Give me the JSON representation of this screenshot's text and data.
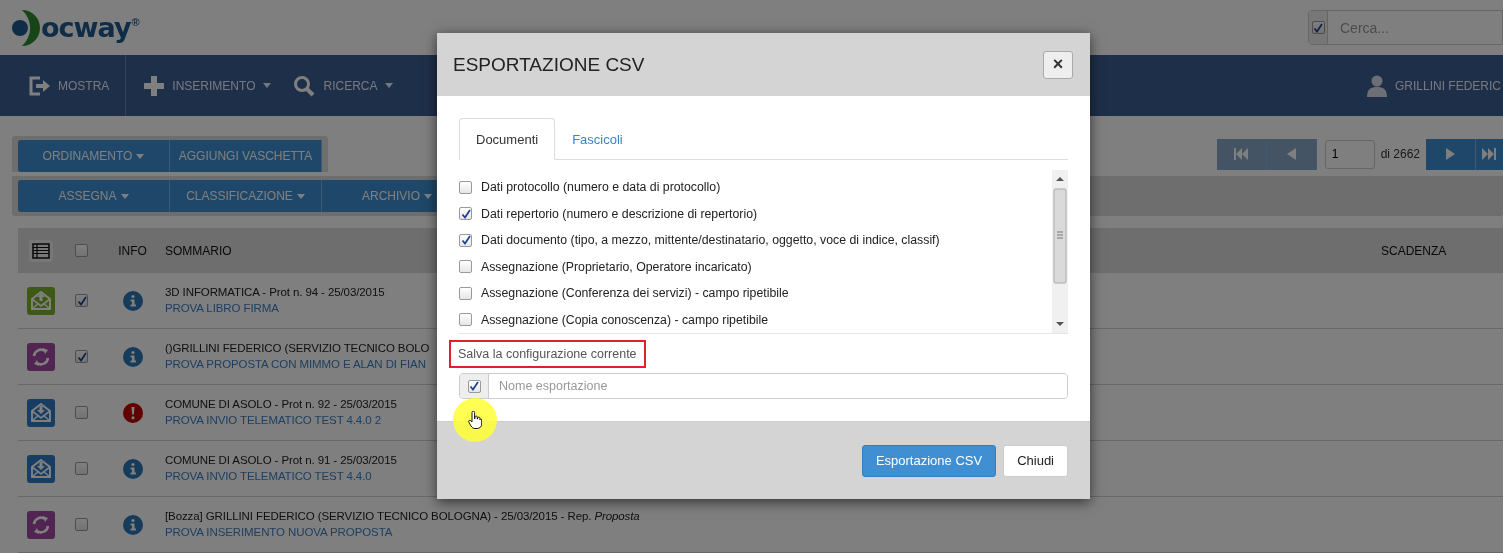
{
  "logo": {
    "text": "ocway",
    "mark": "®"
  },
  "search": {
    "placeholder": "Cerca...",
    "checked": true
  },
  "nav": {
    "items": [
      {
        "label": "MOSTRA",
        "kind": "exit",
        "dropdown": false
      },
      {
        "label": "INSERIMENTO",
        "kind": "plus",
        "dropdown": true
      },
      {
        "label": "RICERCA",
        "kind": "search",
        "dropdown": true
      }
    ],
    "user": "GRILLINI FEDERIC"
  },
  "toolbar": {
    "rows": [
      [
        {
          "label": "ORDINAMENTO",
          "dropdown": true
        },
        {
          "label": "AGGIUNGI VASCHETTA",
          "dropdown": false
        }
      ],
      [
        {
          "label": "ASSEGNA",
          "dropdown": true
        },
        {
          "label": "CLASSIFICAZIONE",
          "dropdown": true
        },
        {
          "label": "ARCHIVIO",
          "dropdown": true
        }
      ]
    ]
  },
  "pagination": {
    "page": "1",
    "total": "di 2662"
  },
  "table": {
    "columns": [
      "INFO",
      "SOMMARIO",
      "SCADENZA"
    ],
    "all_checked": false,
    "rows": [
      {
        "kind": "outgoing",
        "checked": true,
        "alert": false,
        "title": "3D INFORMATICA - Prot n. 94 - 25/03/2015",
        "subtitle": "PROVA LIBRO FIRMA"
      },
      {
        "kind": "proposal",
        "checked": true,
        "alert": false,
        "title": "()GRILLINI FEDERICO (SERVIZIO TECNICO BOLO",
        "subtitle": "PROVA PROPOSTA CON MIMMO E ALAN DI FIAN"
      },
      {
        "kind": "incoming",
        "checked": false,
        "alert": true,
        "title": "COMUNE DI ASOLO - Prot n. 92 - 25/03/2015",
        "subtitle": "PROVA INVIO TELEMATICO TEST 4.4.0 2"
      },
      {
        "kind": "incoming",
        "checked": false,
        "alert": false,
        "title": "COMUNE DI ASOLO - Prot n. 91 - 25/03/2015",
        "subtitle": "PROVA INVIO TELEMATICO TEST 4.4.0"
      },
      {
        "kind": "proposal",
        "checked": false,
        "alert": false,
        "title": "[Bozza] GRILLINI FEDERICO (SERVIZIO TECNICO BOLOGNA) - 25/03/2015 - Rep. *Proposta*",
        "subtitle": "PROVA INSERIMENTO NUOVA PROPOSTA"
      }
    ]
  },
  "modal": {
    "title": "ESPORTAZIONE CSV",
    "close": "×",
    "tabs": [
      {
        "label": "Documenti",
        "selected": true
      },
      {
        "label": "Fascicoli",
        "selected": false
      }
    ],
    "options": [
      {
        "label": "Dati protocollo (numero e data di protocollo)",
        "checked": false
      },
      {
        "label": "Dati repertorio (numero e descrizione di repertorio)",
        "checked": true
      },
      {
        "label": "Dati documento (tipo, a mezzo, mittente/destinatario, oggetto, voce di indice, classif)",
        "checked": true
      },
      {
        "label": "Assegnazione (Proprietario, Operatore incaricato)",
        "checked": false
      },
      {
        "label": "Assegnazione (Conferenza dei servizi) - campo ripetibile",
        "checked": false
      },
      {
        "label": "Assegnazione (Copia conoscenza) - campo ripetibile",
        "checked": false
      }
    ],
    "save_label": "Salva la configurazione corrente",
    "save_highlighted": true,
    "save_checked": true,
    "name_placeholder": "Nome esportazione",
    "buttons": [
      {
        "label": "Esportazione CSV",
        "kind": "primary"
      },
      {
        "label": "Chiudi",
        "kind": "default"
      }
    ]
  }
}
